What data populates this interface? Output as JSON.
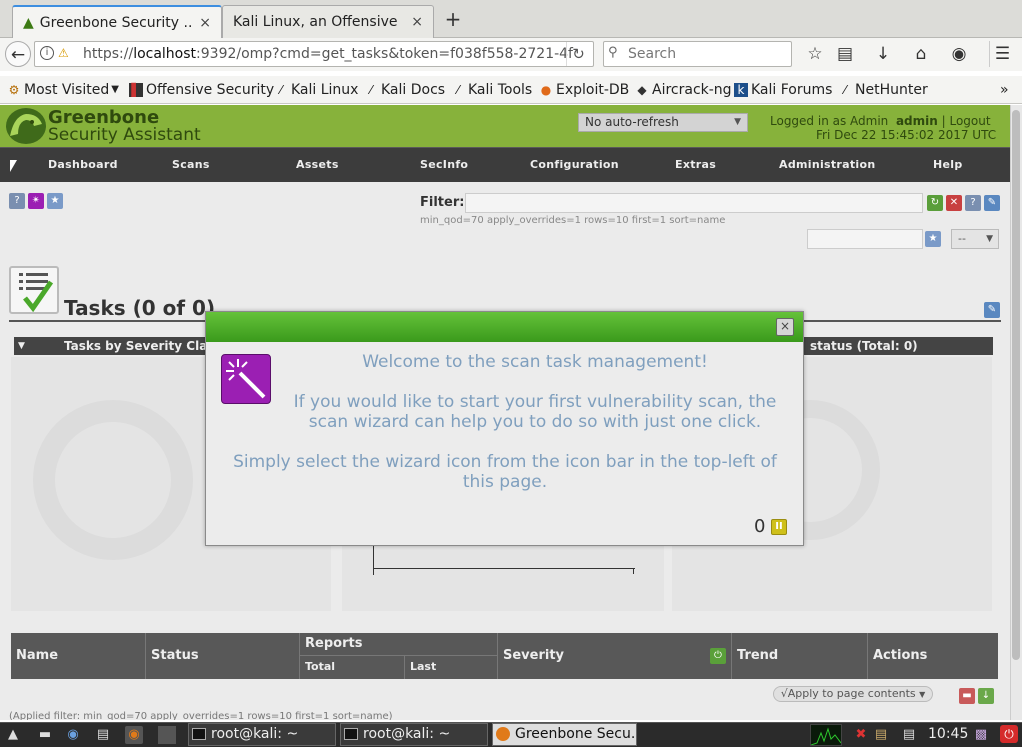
{
  "browser": {
    "tabs": [
      {
        "title": "Greenbone Security ...",
        "close": "×"
      },
      {
        "title": "Kali Linux, an Offensive ...",
        "close": "×"
      }
    ],
    "new_tab": "+",
    "url_prefix": "https://",
    "url_host": "localhost",
    "url_rest": ":9392/omp?cmd=get_tasks&token=f038f558-2721-4f",
    "search_placeholder": "Search",
    "bookmarks": [
      {
        "label": "Most Visited",
        "icon": "gear-icon",
        "icon_glyph": "⚙"
      },
      {
        "label": "Offensive Security",
        "icon": "offsec-icon",
        "icon_glyph": "▌"
      },
      {
        "label": "Kali Linux",
        "icon": "kali-dragon-icon",
        "icon_glyph": "⚔"
      },
      {
        "label": "Kali Docs",
        "icon": "kali-dragon-icon",
        "icon_glyph": "⚔"
      },
      {
        "label": "Kali Tools",
        "icon": "kali-dragon-icon",
        "icon_glyph": "⚔"
      },
      {
        "label": "Exploit-DB",
        "icon": "exploitdb-icon",
        "icon_glyph": "☠"
      },
      {
        "label": "Aircrack-ng",
        "icon": "aircrack-icon",
        "icon_glyph": "◆"
      },
      {
        "label": "Kali Forums",
        "icon": "kali-forums-icon",
        "icon_glyph": "▣"
      },
      {
        "label": "NetHunter",
        "icon": "kali-dragon-icon",
        "icon_glyph": "⚔"
      }
    ],
    "bookmarks_overflow": "»"
  },
  "gsa": {
    "name_line1": "Greenbone",
    "name_line2": "Security Assistant",
    "auto_refresh": "No auto-refresh",
    "logged_in_prefix": "Logged in as  Admin",
    "user": "admin",
    "logout": "Logout",
    "datetime": "Fri Dec 22 15:45:02 2017 UTC",
    "menu": [
      "Dashboard",
      "Scans",
      "Assets",
      "SecInfo",
      "Configuration",
      "Extras",
      "Administration",
      "Help"
    ],
    "filter_label": "Filter:",
    "filter_text": "min_qod=70 apply_overrides=1 rows=10 first=1 sort=name",
    "filter_select": "--",
    "tasks_title": "Tasks (0 of 0)",
    "chart1_title": "Tasks by Severity Cla",
    "chart2_title": "status (Total: 0)",
    "table_headers": {
      "name": "Name",
      "status": "Status",
      "reports": "Reports",
      "total": "Total",
      "last": "Last",
      "severity": "Severity",
      "trend": "Trend",
      "actions": "Actions"
    },
    "apply_to": "√Apply to page contents",
    "applied_filter": "(Applied filter: min_qod=70 apply_overrides=1 rows=10 first=1 sort=name)"
  },
  "dialog": {
    "line1": "Welcome to the scan task management!",
    "line2": "If you would like to start your first vulnerability scan, the scan wizard can help you to do so with just one click.",
    "line3": "Simply select the wizard icon from the icon bar in the top-left of this page.",
    "counter": "0",
    "close": "×"
  },
  "taskbar": {
    "buttons": [
      "root@kali: ~",
      "root@kali: ~",
      "Greenbone Secu..."
    ],
    "clock": "10:45"
  },
  "colors": {
    "gsa_green": "#87b23b",
    "menu_bg": "#3c3c3c",
    "dialog_title": "#4fae2a",
    "dialog_text": "#7f9fbe",
    "wizard_purple": "#9b1fb3"
  }
}
